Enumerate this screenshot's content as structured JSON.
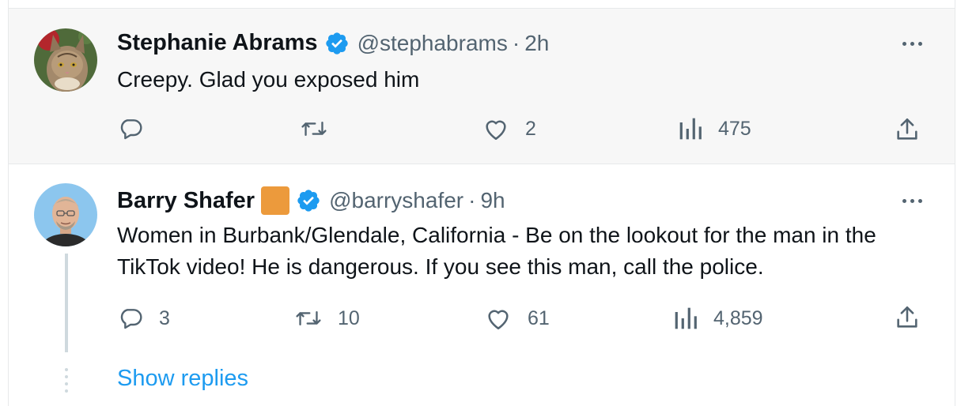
{
  "tweets": [
    {
      "author_name": "Stephanie Abrams",
      "verified": true,
      "handle": "@stephabrams",
      "separator": "·",
      "time": "2h",
      "text": "Creepy.  Glad you exposed him",
      "reply_count": "",
      "retweet_count": "",
      "like_count": "2",
      "view_count": "475"
    },
    {
      "author_name": "Barry Shafer",
      "verified": true,
      "org_badge_color": "#ec9a3c",
      "handle": "@barryshafer",
      "separator": "·",
      "time": "9h",
      "text": "Women in Burbank/Glendale, California - Be on the lookout for the man in the TikTok video! He is dangerous. If you see this man, call the police.",
      "reply_count": "3",
      "retweet_count": "10",
      "like_count": "61",
      "view_count": "4,859"
    }
  ],
  "show_replies_label": "Show replies",
  "icons": {
    "reply": "reply-icon",
    "retweet": "retweet-icon",
    "like": "heart-icon",
    "views": "views-icon",
    "share": "share-icon",
    "verified": "verified-badge-icon",
    "more": "more-options-icon"
  },
  "colors": {
    "verified_blue": "#1d9bf0",
    "link_blue": "#1d9bf0",
    "muted_text": "#536471",
    "highlight_bg": "#f7f7f7"
  }
}
